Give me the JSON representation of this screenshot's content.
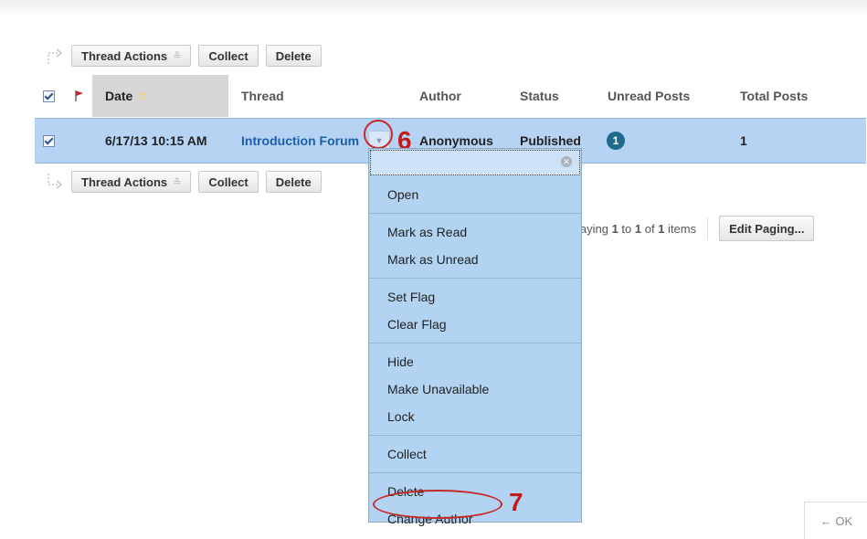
{
  "toolbar": {
    "thread_actions_label": "Thread Actions",
    "collect_label": "Collect",
    "delete_label": "Delete"
  },
  "table": {
    "headers": {
      "date": "Date",
      "thread": "Thread",
      "author": "Author",
      "status": "Status",
      "unread": "Unread Posts",
      "total": "Total Posts"
    },
    "row": {
      "date": "6/17/13 10:15 AM",
      "thread": "Introduction Forum",
      "author": "Anonymous",
      "status": "Published",
      "unread": "1",
      "total": "1"
    }
  },
  "paging": {
    "prefix": "laying ",
    "from": "1",
    "to_word": " to ",
    "to": "1",
    "of_word": " of ",
    "count": "1",
    "suffix": " items",
    "edit_label": "Edit Paging..."
  },
  "menu": {
    "open": "Open",
    "mark_read": "Mark as Read",
    "mark_unread": "Mark as Unread",
    "set_flag": "Set Flag",
    "clear_flag": "Clear Flag",
    "hide": "Hide",
    "make_unavailable": "Make Unavailable",
    "lock": "Lock",
    "collect": "Collect",
    "delete": "Delete",
    "change_author": "Change Author"
  },
  "callouts": {
    "six": "6",
    "seven": "7"
  },
  "ok_label": "← OK",
  "colors": {
    "row_highlight": "#b7d3f3",
    "menu_bg": "#b2d3f1",
    "link": "#1c5ea8",
    "callout_red": "#c32b2b",
    "badge": "#1e6b8e"
  },
  "icons": {
    "flag": "flag-icon",
    "sort": "sort-descending-icon",
    "chevron": "chevron-down-icon",
    "close": "close-icon"
  }
}
